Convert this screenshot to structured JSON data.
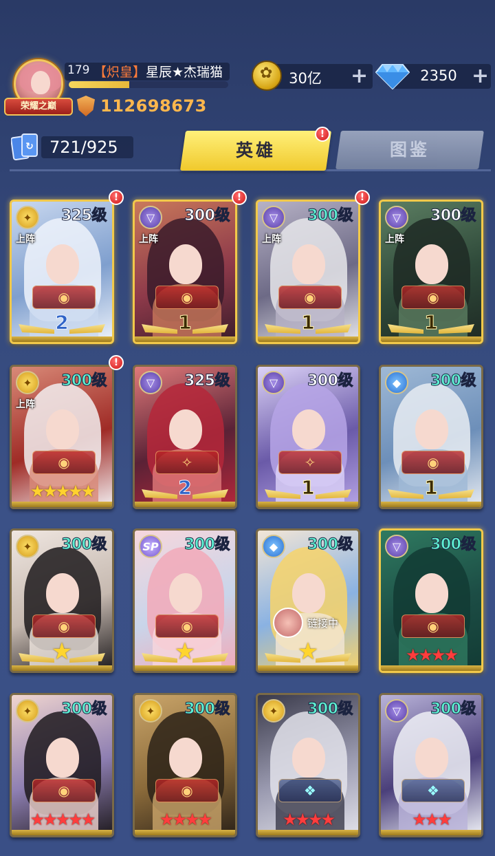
{
  "header": {
    "player_level": "179",
    "guild_tag": "【炽皇】",
    "player_name": "星辰★杰瑞猫",
    "rank_title": "荣耀之巅",
    "combat_power": "112698673",
    "exp_progress": 0.38,
    "gold": "30亿",
    "diamonds": "2350",
    "plus_symbol": "+"
  },
  "collection": {
    "count": "721/925"
  },
  "tabs": [
    {
      "label": "英雄",
      "active": true
    },
    {
      "label": "图鉴",
      "active": false
    }
  ],
  "alert_symbol": "!",
  "deploy_label": "上阵",
  "cards": [
    {
      "level": "325级",
      "level_color": "white",
      "class": "gold",
      "class_glyph": "✦",
      "deployed": true,
      "alert": true,
      "frame": "gold",
      "rank": {
        "type": "wings",
        "value": "2",
        "style": "blue"
      },
      "palette": [
        "#eef3fb",
        "#c9d8ef",
        "#7f9fce"
      ]
    },
    {
      "level": "300级",
      "level_color": "white",
      "class": "purple",
      "class_glyph": "▽",
      "deployed": true,
      "alert": true,
      "frame": "gold",
      "rank": {
        "type": "wings",
        "value": "1",
        "style": "gold"
      },
      "palette": [
        "#3a1b2a",
        "#c9795b",
        "#8e3a4a"
      ]
    },
    {
      "level": "300级",
      "level_color": "cyan",
      "class": "purple",
      "class_glyph": "▽",
      "deployed": true,
      "alert": true,
      "frame": "gold",
      "rank": {
        "type": "wings",
        "value": "1",
        "style": "gold"
      },
      "palette": [
        "#e6e6ea",
        "#b7b2c6",
        "#6d6a86"
      ]
    },
    {
      "level": "300级",
      "level_color": "white",
      "class": "purple",
      "class_glyph": "▽",
      "deployed": true,
      "alert": false,
      "frame": "gold",
      "rank": {
        "type": "wings",
        "value": "1",
        "style": "gold"
      },
      "palette": [
        "#1f2a24",
        "#5c7e62",
        "#2f4a3a"
      ]
    },
    {
      "level": "300级",
      "level_color": "cyan",
      "class": "gold",
      "class_glyph": "✦",
      "deployed": true,
      "alert": true,
      "frame": "normal",
      "rank": {
        "type": "stars",
        "value": "★★★★★",
        "style": "gold"
      },
      "palette": [
        "#f2eef0",
        "#d98a78",
        "#9f2b26"
      ]
    },
    {
      "level": "325级",
      "level_color": "white",
      "class": "purple",
      "class_glyph": "▽",
      "deployed": false,
      "alert": false,
      "frame": "normal",
      "rank": {
        "type": "wings",
        "value": "2",
        "style": "blue"
      },
      "palette": [
        "#b5273a",
        "#e07a7a",
        "#5a2236"
      ]
    },
    {
      "level": "300级",
      "level_color": "white",
      "class": "purple",
      "class_glyph": "▽",
      "deployed": false,
      "alert": false,
      "frame": "normal",
      "rank": {
        "type": "wings",
        "value": "1",
        "style": "gold"
      },
      "palette": [
        "#b6a4e6",
        "#dcd2f7",
        "#6a5aa8"
      ]
    },
    {
      "level": "300级",
      "level_color": "cyan",
      "class": "blue",
      "class_glyph": "◆",
      "deployed": false,
      "alert": false,
      "frame": "normal",
      "rank": {
        "type": "wings",
        "value": "1",
        "style": "gold"
      },
      "palette": [
        "#e8ecf2",
        "#9fb9d6",
        "#6d8fb9"
      ]
    },
    {
      "level": "300级",
      "level_color": "cyan",
      "class": "gold",
      "class_glyph": "✦",
      "deployed": false,
      "alert": false,
      "frame": "normal",
      "rank": {
        "type": "star-wings",
        "value": "★",
        "style": "gold"
      },
      "palette": [
        "#1d1a1c",
        "#efe6e0",
        "#c6b9b0"
      ]
    },
    {
      "level": "300级",
      "level_color": "cyan",
      "class": "sp",
      "class_glyph": "SP",
      "deployed": false,
      "alert": false,
      "frame": "normal",
      "rank": {
        "type": "star-wings",
        "value": "★",
        "style": "gold"
      },
      "palette": [
        "#f2a9b8",
        "#f7d6dc",
        "#c9d5ea"
      ]
    },
    {
      "level": "300级",
      "level_color": "cyan",
      "class": "blue",
      "class_glyph": "◆",
      "deployed": false,
      "alert": false,
      "frame": "normal",
      "rank": {
        "type": "star-wings",
        "value": "★",
        "style": "gold"
      },
      "linking": "链接中",
      "palette": [
        "#f7d36a",
        "#f3e6d6",
        "#8ab2e2"
      ]
    },
    {
      "level": "300级",
      "level_color": "cyan",
      "class": "purple",
      "class_glyph": "▽",
      "deployed": false,
      "alert": false,
      "frame": "gold",
      "rank": {
        "type": "stars",
        "value": "★★★★",
        "style": "red"
      },
      "palette": [
        "#123b34",
        "#2f7a60",
        "#1c4d45"
      ]
    },
    {
      "level": "300级",
      "level_color": "cyan",
      "class": "gold",
      "class_glyph": "✦",
      "deployed": false,
      "alert": false,
      "frame": "normal",
      "rank": {
        "type": "stars",
        "value": "★★★★★",
        "style": "red"
      },
      "palette": [
        "#1f1a1e",
        "#f0d5cf",
        "#8e7fb2"
      ]
    },
    {
      "level": "300级",
      "level_color": "cyan",
      "class": "gold",
      "class_glyph": "✦",
      "deployed": false,
      "alert": false,
      "frame": "normal",
      "rank": {
        "type": "stars",
        "value": "★★★★",
        "style": "red"
      },
      "palette": [
        "#2c2218",
        "#caa56a",
        "#8a6a3a"
      ]
    },
    {
      "level": "300级",
      "level_color": "cyan",
      "class": "gold",
      "class_glyph": "✦",
      "deployed": false,
      "alert": false,
      "frame": "normal",
      "rank": {
        "type": "stars",
        "value": "★★★★",
        "style": "red"
      },
      "palette": [
        "#e2e2ea",
        "#3a3a4a",
        "#9a9ab0"
      ]
    },
    {
      "level": "300级",
      "level_color": "cyan",
      "class": "purple",
      "class_glyph": "▽",
      "deployed": false,
      "alert": false,
      "frame": "normal",
      "rank": {
        "type": "stars",
        "value": "★★★",
        "style": "red"
      },
      "palette": [
        "#eef0f6",
        "#b9b3d9",
        "#4a3f7a"
      ]
    }
  ]
}
